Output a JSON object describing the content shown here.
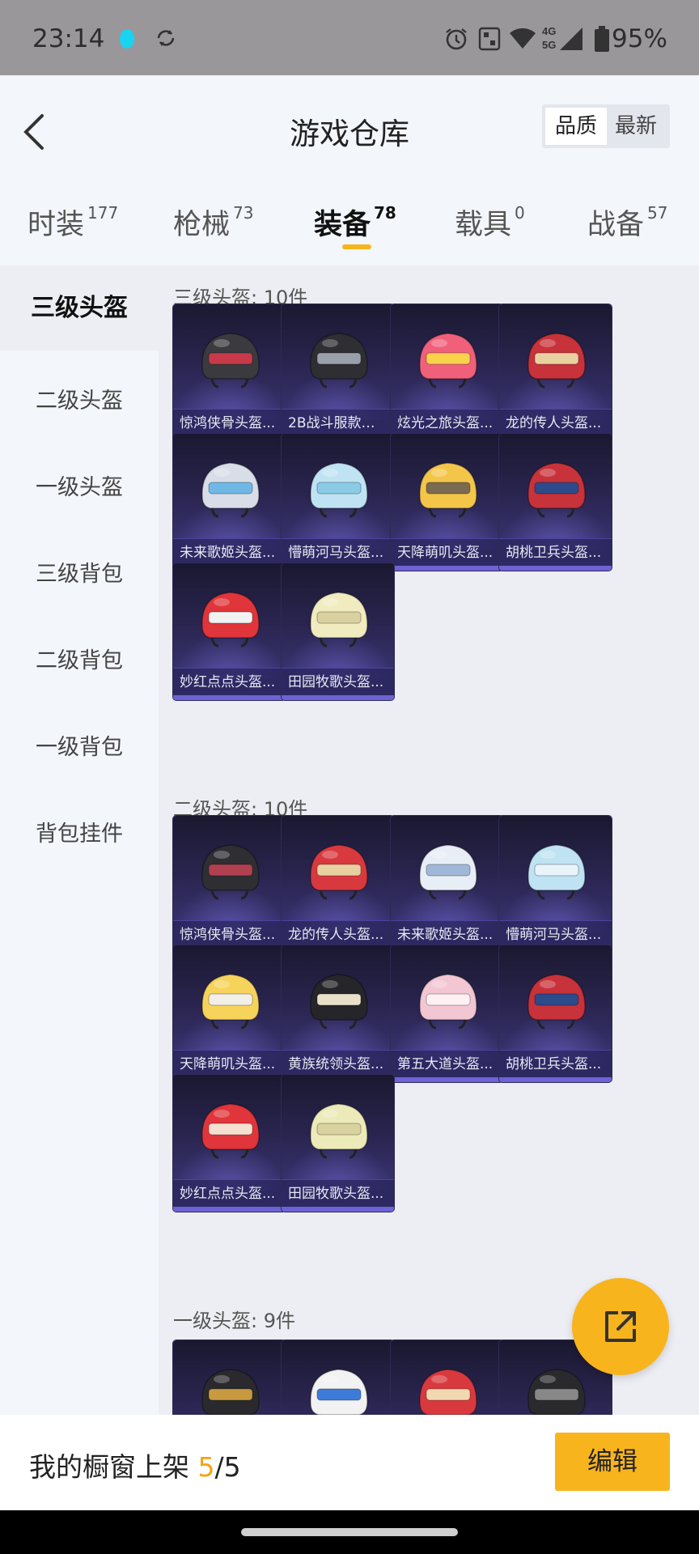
{
  "status_bar": {
    "time": "23:14",
    "battery": "95%",
    "network": "4G 5G"
  },
  "header": {
    "title": "游戏仓库",
    "sort_options": [
      "品质",
      "最新"
    ],
    "sort_selected": "品质"
  },
  "tabs": [
    {
      "label": "时装",
      "count": "177"
    },
    {
      "label": "枪械",
      "count": "73"
    },
    {
      "label": "装备",
      "count": "78"
    },
    {
      "label": "载具",
      "count": "0"
    },
    {
      "label": "战备",
      "count": "57"
    }
  ],
  "active_tab": "装备",
  "sidebar": {
    "items": [
      "三级头盔",
      "二级头盔",
      "一级头盔",
      "三级背包",
      "二级背包",
      "一级背包",
      "背包挂件"
    ],
    "active": "三级头盔"
  },
  "sections": [
    {
      "title": "三级头盔: 10件",
      "items": [
        "惊鸿侠骨头盔...",
        "2B战斗服款头...",
        "炫光之旅头盔...",
        "龙的传人头盔...",
        "未来歌姬头盔...",
        "懵萌河马头盔...",
        "天降萌叽头盔...",
        "胡桃卫兵头盔...",
        "妙红点点头盔...",
        "田园牧歌头盔..."
      ]
    },
    {
      "title": "二级头盔: 10件",
      "items": [
        "惊鸿侠骨头盔...",
        "龙的传人头盔...",
        "未来歌姬头盔...",
        "懵萌河马头盔...",
        "天降萌叽头盔...",
        "黄族统领头盔...",
        "第五大道头盔...",
        "胡桃卫兵头盔...",
        "妙红点点头盔...",
        "田园牧歌头盔..."
      ]
    },
    {
      "title": "一级头盔: 9件",
      "items": [
        "",
        "",
        "",
        ""
      ]
    }
  ],
  "colors": {
    "accent": "#f8b41d",
    "card_bg": "#2a2550",
    "card_border": "#6f62d6"
  },
  "bottom_bar": {
    "label": "我的橱窗上架",
    "current": "5",
    "total": "/5",
    "edit_label": "编辑"
  },
  "icons": [
    "back-arrow-icon",
    "share-out-icon",
    "alarm-icon",
    "nfc-icon",
    "wifi-icon",
    "signal-icon",
    "battery-icon",
    "sync-icon",
    "notification-dot-icon"
  ]
}
